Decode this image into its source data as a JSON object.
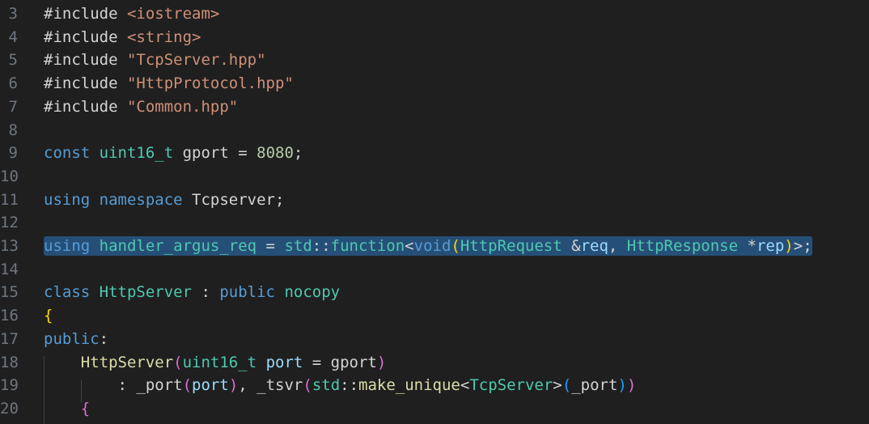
{
  "colors": {
    "background": "#1f1f1f",
    "line_number": "#6e7681",
    "selection": "#264f78",
    "default": "#d4d4d4",
    "keyword": "#569cd6",
    "control_keyword": "#c586c0",
    "type": "#4ec9b0",
    "string": "#ce9178",
    "number": "#b5cea8",
    "function": "#dcdcaa",
    "variable": "#9cdcfe",
    "bracket_gold": "#ffd700",
    "bracket_pink": "#da70d6",
    "bracket_blue": "#179fff"
  },
  "lines": [
    {
      "number": "3",
      "tokens": [
        {
          "t": "#include ",
          "c": "keyword_pre"
        },
        {
          "t": "<iostream>",
          "c": "string"
        }
      ]
    },
    {
      "number": "4",
      "tokens": [
        {
          "t": "#include ",
          "c": "keyword_pre"
        },
        {
          "t": "<string>",
          "c": "string"
        }
      ]
    },
    {
      "number": "5",
      "tokens": [
        {
          "t": "#include ",
          "c": "keyword_pre"
        },
        {
          "t": "\"TcpServer.hpp\"",
          "c": "string"
        }
      ]
    },
    {
      "number": "6",
      "tokens": [
        {
          "t": "#include ",
          "c": "keyword_pre"
        },
        {
          "t": "\"HttpProtocol.hpp\"",
          "c": "string"
        }
      ]
    },
    {
      "number": "7",
      "tokens": [
        {
          "t": "#include ",
          "c": "keyword_pre"
        },
        {
          "t": "\"Common.hpp\"",
          "c": "string"
        }
      ]
    },
    {
      "number": "8",
      "tokens": []
    },
    {
      "number": "9",
      "tokens": [
        {
          "t": "const ",
          "c": "keyword"
        },
        {
          "t": "uint16_t",
          "c": "type"
        },
        {
          "t": " gport ",
          "c": "default"
        },
        {
          "t": "= ",
          "c": "default"
        },
        {
          "t": "8080",
          "c": "number"
        },
        {
          "t": ";",
          "c": "default"
        }
      ]
    },
    {
      "number": "10",
      "tokens": []
    },
    {
      "number": "11",
      "tokens": [
        {
          "t": "using ",
          "c": "keyword"
        },
        {
          "t": "namespace ",
          "c": "keyword"
        },
        {
          "t": "Tcpserver",
          "c": "default"
        },
        {
          "t": ";",
          "c": "default"
        }
      ]
    },
    {
      "number": "12",
      "tokens": []
    },
    {
      "number": "13",
      "selected": true,
      "tokens": [
        {
          "t": "using ",
          "c": "keyword"
        },
        {
          "t": "handler_argus_req",
          "c": "type"
        },
        {
          "t": " = ",
          "c": "default"
        },
        {
          "t": "std",
          "c": "type"
        },
        {
          "t": "::",
          "c": "default"
        },
        {
          "t": "function",
          "c": "type"
        },
        {
          "t": "<",
          "c": "default"
        },
        {
          "t": "void",
          "c": "keyword"
        },
        {
          "t": "(",
          "c": "bracket_gold"
        },
        {
          "t": "HttpRequest",
          "c": "type"
        },
        {
          "t": " &",
          "c": "default"
        },
        {
          "t": "req",
          "c": "variable"
        },
        {
          "t": ", ",
          "c": "default"
        },
        {
          "t": "HttpResponse",
          "c": "type"
        },
        {
          "t": " *",
          "c": "default"
        },
        {
          "t": "rep",
          "c": "variable"
        },
        {
          "t": ")",
          "c": "bracket_gold"
        },
        {
          "t": ">;",
          "c": "default"
        }
      ]
    },
    {
      "number": "14",
      "tokens": []
    },
    {
      "number": "15",
      "tokens": [
        {
          "t": "class ",
          "c": "keyword"
        },
        {
          "t": "HttpServer",
          "c": "type"
        },
        {
          "t": " : ",
          "c": "default"
        },
        {
          "t": "public ",
          "c": "keyword"
        },
        {
          "t": "nocopy",
          "c": "type"
        }
      ]
    },
    {
      "number": "16",
      "tokens": [
        {
          "t": "{",
          "c": "bracket_gold"
        }
      ]
    },
    {
      "number": "17",
      "tokens": [
        {
          "t": "public",
          "c": "keyword"
        },
        {
          "t": ":",
          "c": "default"
        }
      ]
    },
    {
      "number": "18",
      "tokens": [
        {
          "t": "    ",
          "c": "default"
        },
        {
          "t": "HttpServer",
          "c": "function"
        },
        {
          "t": "(",
          "c": "bracket_pink"
        },
        {
          "t": "uint16_t",
          "c": "type"
        },
        {
          "t": " port ",
          "c": "variable"
        },
        {
          "t": "= ",
          "c": "default"
        },
        {
          "t": "gport",
          "c": "default"
        },
        {
          "t": ")",
          "c": "bracket_pink"
        }
      ]
    },
    {
      "number": "19",
      "tokens": [
        {
          "t": "        : ",
          "c": "default"
        },
        {
          "t": "_port",
          "c": "default"
        },
        {
          "t": "(",
          "c": "bracket_pink"
        },
        {
          "t": "port",
          "c": "variable"
        },
        {
          "t": ")",
          "c": "bracket_pink"
        },
        {
          "t": ", ",
          "c": "default"
        },
        {
          "t": "_tsvr",
          "c": "default"
        },
        {
          "t": "(",
          "c": "bracket_pink"
        },
        {
          "t": "std",
          "c": "type"
        },
        {
          "t": "::",
          "c": "default"
        },
        {
          "t": "make_unique",
          "c": "function"
        },
        {
          "t": "<",
          "c": "default"
        },
        {
          "t": "TcpServer",
          "c": "type"
        },
        {
          "t": ">",
          "c": "default"
        },
        {
          "t": "(",
          "c": "bracket_blue"
        },
        {
          "t": "_port",
          "c": "default"
        },
        {
          "t": ")",
          "c": "bracket_blue"
        },
        {
          "t": ")",
          "c": "bracket_pink"
        }
      ]
    },
    {
      "number": "20",
      "tokens": [
        {
          "t": "    ",
          "c": "default"
        },
        {
          "t": "{",
          "c": "bracket_pink"
        }
      ]
    }
  ]
}
